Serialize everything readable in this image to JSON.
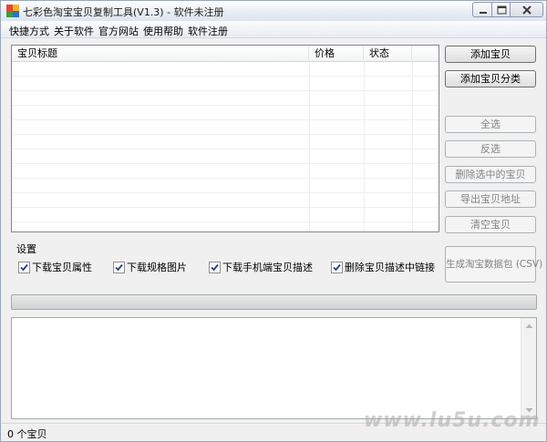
{
  "window": {
    "title": "七彩色淘宝宝贝复制工具(V1.3) - 软件未注册"
  },
  "menu": {
    "items": [
      "快捷方式",
      "关于软件",
      "官方网站",
      "使用帮助",
      "软件注册"
    ]
  },
  "list": {
    "columns": [
      "宝贝标题",
      "价格",
      "状态"
    ],
    "rows": []
  },
  "buttons": {
    "add_item": "添加宝贝",
    "add_category": "添加宝贝分类",
    "select_all": "全选",
    "invert_selection": "反选",
    "delete_selected": "删除选中的宝贝",
    "export_urls": "导出宝贝地址",
    "clear_items": "清空宝贝",
    "generate_package": "生成淘宝数据包 (CSV)"
  },
  "settings": {
    "label": "设置",
    "options": [
      {
        "label": "下载宝贝属性",
        "checked": true
      },
      {
        "label": "下载规格图片",
        "checked": true
      },
      {
        "label": "下载手机端宝贝描述",
        "checked": true
      },
      {
        "label": "删除宝贝描述中链接",
        "checked": true
      }
    ]
  },
  "progress": {
    "value": 0
  },
  "log": {
    "text": ""
  },
  "status": {
    "text": "0 个宝贝"
  },
  "watermark": {
    "text": "www.lu5u.com"
  },
  "colors": {
    "window_border": "#9aa7b7",
    "check_mark": "#1f3f8f",
    "face": "#f0f0f0"
  }
}
